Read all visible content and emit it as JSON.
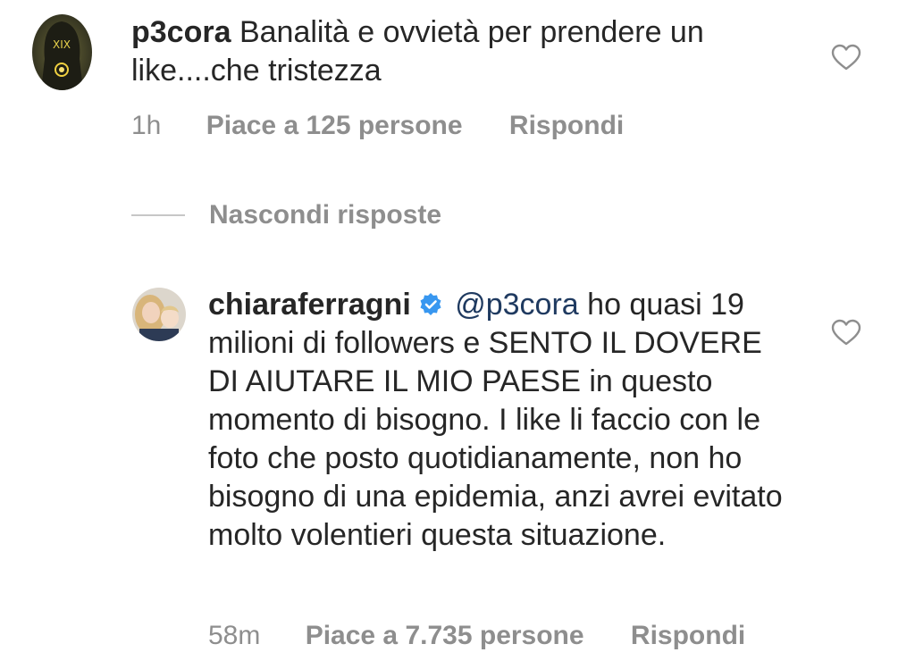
{
  "comment": {
    "username": "p3cora",
    "text": "Banalità e ovvietà per prendere un like....che tristezza",
    "time": "1h",
    "likes": "Piace a 125 persone",
    "reply_label": "Rispondi"
  },
  "replies_toggle": {
    "label": "Nascondi risposte"
  },
  "reply": {
    "username": "chiaraferragni",
    "mention": "@p3cora",
    "text": "ho quasi 19 milioni di followers e SENTO IL DOVERE DI AIUTARE IL MIO PAESE in questo momento di bisogno. I like li faccio con le foto che posto quotidianamente, non ho bisogno di una epidemia, anzi avrei evitato molto volentieri questa situazione.",
    "time": "58m",
    "likes": "Piace a 7.735 persone",
    "reply_label": "Rispondi"
  },
  "icons": {
    "comment_like": "heart-outline-icon",
    "reply_like": "heart-outline-icon",
    "verified": "verified-badge-icon"
  },
  "colors": {
    "text": "#262626",
    "meta": "#8e8e8e",
    "mention": "#1f3a60",
    "verified": "#3897f0"
  }
}
